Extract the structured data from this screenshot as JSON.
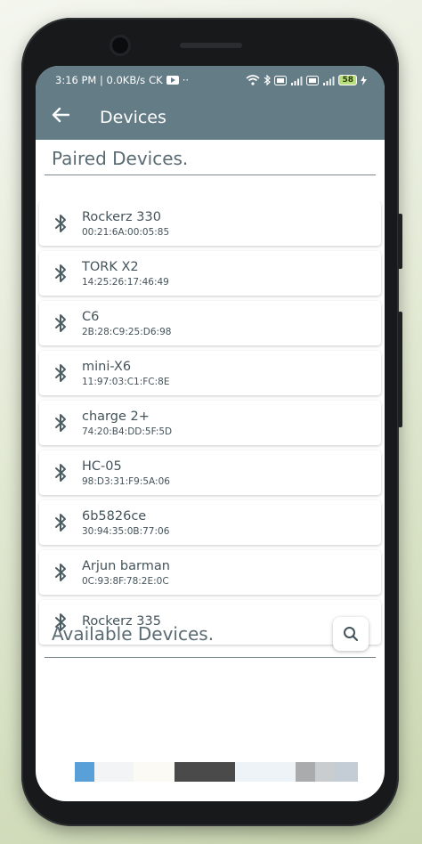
{
  "status_bar": {
    "time_speed": "3:16 PM | 0.0KB/s",
    "carrier_icon": "CK",
    "dots": "··",
    "battery": "58"
  },
  "app_bar": {
    "title": "Devices"
  },
  "paired": {
    "title": "Paired Devices.",
    "devices": [
      {
        "name": "Rockerz 330",
        "mac": "00:21:6A:00:05:85"
      },
      {
        "name": "TORK X2",
        "mac": "14:25:26:17:46:49"
      },
      {
        "name": "C6",
        "mac": "2B:28:C9:25:D6:98"
      },
      {
        "name": "mini-X6",
        "mac": "11:97:03:C1:FC:8E"
      },
      {
        "name": "charge 2+",
        "mac": "74:20:B4:DD:5F:5D"
      },
      {
        "name": "HC-05",
        "mac": "98:D3:31:F9:5A:06"
      },
      {
        "name": "6b5826ce",
        "mac": "30:94:35:0B:77:06"
      },
      {
        "name": "Arjun barman",
        "mac": "0C:93:8F:78:2E:0C"
      },
      {
        "name": "Rockerz 335",
        "mac": ""
      }
    ]
  },
  "available": {
    "title": "Available Devices."
  },
  "colors": {
    "appbar": "#647c86",
    "text": "#44535a"
  }
}
